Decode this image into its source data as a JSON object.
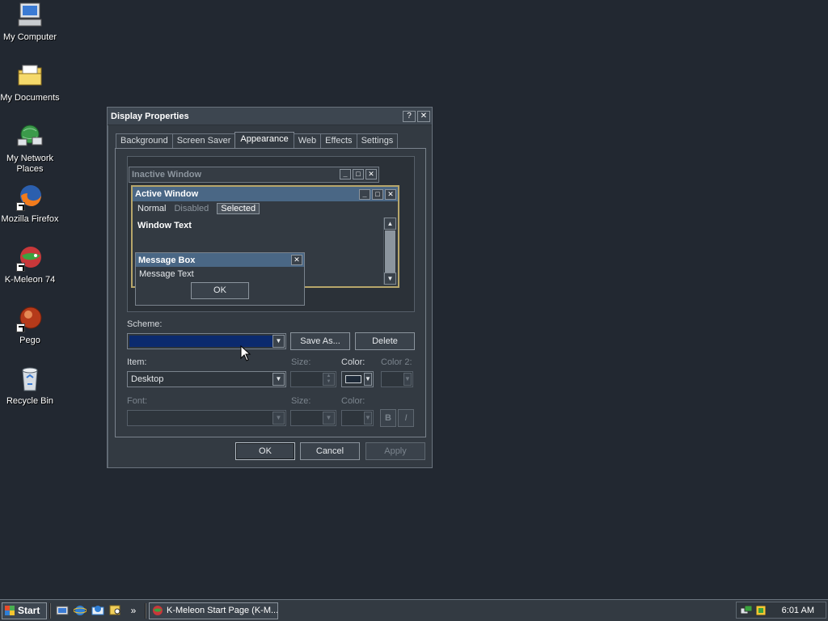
{
  "desktop": {
    "icons": [
      {
        "label": "My Computer",
        "icon": "computer-icon"
      },
      {
        "label": "My Documents",
        "icon": "folder-icon"
      },
      {
        "label": "My Network Places",
        "icon": "network-icon"
      },
      {
        "label": "Mozilla Firefox",
        "icon": "firefox-icon"
      },
      {
        "label": "K-Meleon 74",
        "icon": "kmeleon-icon"
      },
      {
        "label": "Pego",
        "icon": "pego-icon"
      },
      {
        "label": "Recycle Bin",
        "icon": "recycle-bin-icon"
      }
    ]
  },
  "dialog": {
    "title": "Display Properties",
    "help_btn": "?",
    "close_btn": "✕",
    "tabs": [
      "Background",
      "Screen Saver",
      "Appearance",
      "Web",
      "Effects",
      "Settings"
    ],
    "active_tab": "Appearance",
    "preview": {
      "inactive_title": "Inactive Window",
      "active_title": "Active Window",
      "menu_normal": "Normal",
      "menu_disabled": "Disabled",
      "menu_selected": "Selected",
      "window_text": "Window Text",
      "msgbox_title": "Message Box",
      "msgbox_text": "Message Text",
      "msgbox_ok": "OK"
    },
    "scheme_label": "Scheme:",
    "scheme_value": "",
    "save_as": "Save As...",
    "delete": "Delete",
    "item_label": "Item:",
    "item_value": "Desktop",
    "size_label": "Size:",
    "color_label": "Color:",
    "color2_label": "Color 2:",
    "font_label": "Font:",
    "font_size_label": "Size:",
    "font_color_label": "Color:",
    "bold": "B",
    "italic": "I",
    "ok": "OK",
    "cancel": "Cancel",
    "apply": "Apply",
    "colors": {
      "scheme_fill": "#0b2a6e",
      "swatch": "#1e2a38"
    }
  },
  "taskbar": {
    "start": "Start",
    "chevron": "»",
    "task_label": "K-Meleon Start Page (K-M...",
    "clock": "6:01 AM"
  }
}
